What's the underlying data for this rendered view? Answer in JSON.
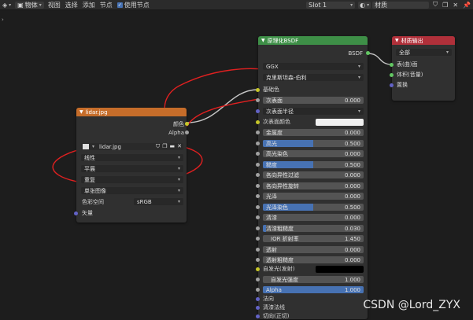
{
  "toolbar": {
    "mode": "物体",
    "menus": [
      "视图",
      "选择",
      "添加",
      "节点"
    ],
    "use_nodes_label": "使用节点",
    "use_nodes_checked": true,
    "slot": "Slot 1",
    "material": "材质",
    "colors": {
      "bg": "#2b2b2b",
      "accent": "#4772b3"
    }
  },
  "image_node": {
    "title": "lidar.jpg",
    "out_color": "颜色",
    "out_alpha": "Alpha",
    "image_name": "lidar.jpg",
    "interpolation": "线性",
    "projection": "平展",
    "extension": "重复",
    "source": "单张图像",
    "colorspace_label": "色彩空间",
    "colorspace": "sRGB",
    "vector": "矢量",
    "header_color": "#c66d2a"
  },
  "bsdf_node": {
    "title": "原理化BSDF",
    "out_bsdf": "BSDF",
    "distribution": "GGX",
    "subsurface_method": "克里斯坦森-伯利",
    "base_color": "基础色",
    "subsurface": {
      "label": "次表面",
      "value": "0.000"
    },
    "subsurface_radius": "次表面半径",
    "subsurface_color": "次表面颜色",
    "metallic": {
      "label": "金属度",
      "value": "0.000"
    },
    "specular": {
      "label": "高光",
      "value": "0.500",
      "fill": 0.5
    },
    "specular_tint": {
      "label": "高光染色",
      "value": "0.000"
    },
    "roughness": {
      "label": "糙度",
      "value": "0.500",
      "fill": 0.5
    },
    "anisotropic": {
      "label": "各向异性过滤",
      "value": "0.000"
    },
    "anisotropic_rotation": {
      "label": "各向异性旋转",
      "value": "0.000"
    },
    "sheen": {
      "label": "光泽",
      "value": "0.000"
    },
    "sheen_tint": {
      "label": "光泽染色",
      "value": "0.500",
      "fill": 0.5
    },
    "clearcoat": {
      "label": "清漆",
      "value": "0.000"
    },
    "clearcoat_roughness": {
      "label": "清漆粗糙度",
      "value": "0.030",
      "fill": 0.03
    },
    "ior": {
      "label": "IOR 折射率",
      "value": "1.450"
    },
    "transmission": {
      "label": "透射",
      "value": "0.000"
    },
    "transmission_roughness": {
      "label": "透射粗糙度",
      "value": "0.000"
    },
    "emission": "自发光(发射)",
    "emission_strength": {
      "label": "自发光强度",
      "value": "1.000"
    },
    "alpha": {
      "label": "Alpha",
      "value": "1.000",
      "fill": 1.0
    },
    "normal": "法向",
    "clearcoat_normal": "清漆法线",
    "tangent": "切向(正切)",
    "header_color": "#3e8f47"
  },
  "output_node": {
    "title": "材质输出",
    "target": "全部",
    "surface": "表(曲)面",
    "volume": "体积(音量)",
    "displacement": "置换",
    "header_color": "#b0303a"
  },
  "watermark": "CSDN @Lord_ZYX"
}
